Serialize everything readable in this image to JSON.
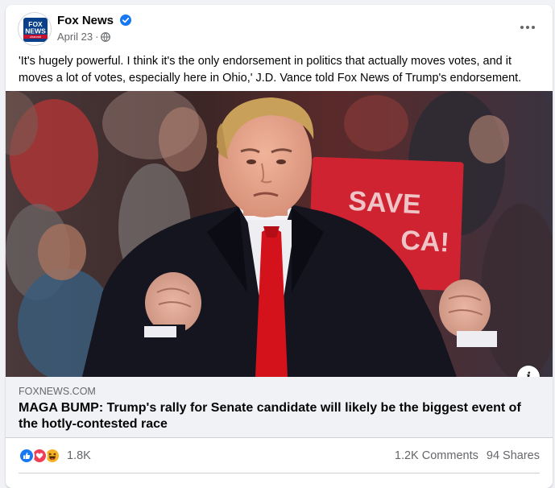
{
  "post": {
    "page_name": "Fox News",
    "date": "April 23",
    "separator": "·",
    "caption": "'It's hugely powerful. I think it's the only endorsement in politics that actually moves votes, and it moves a lot of votes, especially here in Ohio,' J.D. Vance told Fox News of Trump's endorsement."
  },
  "avatar": {
    "logo_line1": "FOX",
    "logo_line2": "NEWS",
    "logo_line3": "channel"
  },
  "photo": {
    "sign_line1": "SAVE",
    "sign_line2": "CA!"
  },
  "link": {
    "domain": "FOXNEWS.COM",
    "headline": "MAGA BUMP: Trump's rally for Senate candidate will likely be the biggest event of the hotly-contested race"
  },
  "stats": {
    "reaction_count": "1.8K",
    "comments": "1.2K Comments",
    "shares": "94 Shares"
  },
  "icons": {
    "more": "more-options-icon",
    "verified": "verified-badge-icon",
    "audience": "globe-icon",
    "info": "info-icon"
  },
  "colors": {
    "fb_blue": "#1877f2",
    "love_red": "#f33e58",
    "haha_yellow": "#f7b125",
    "tie_red": "#d4121c"
  }
}
